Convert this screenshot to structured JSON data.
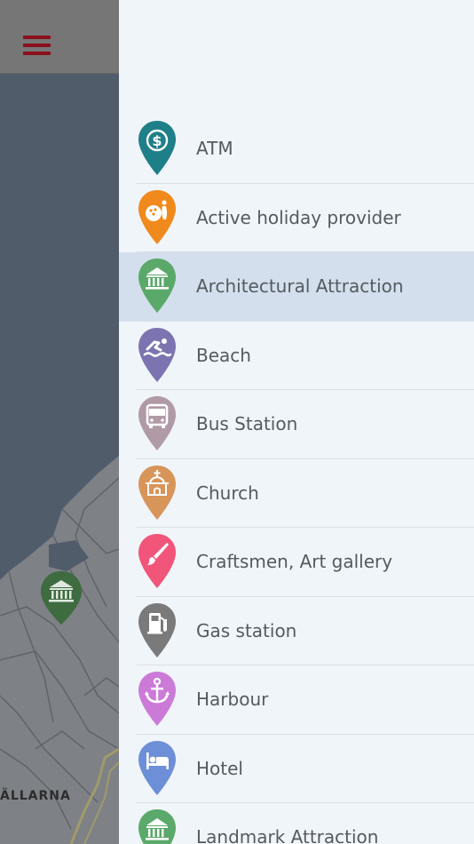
{
  "map": {
    "district_label": "ÄLLARNA",
    "marker_icon": "museum-icon",
    "marker_color": "#3e6b40"
  },
  "header": {
    "menu_icon": "hamburger-menu-icon",
    "menu_color": "#8b0f1a"
  },
  "drawer": {
    "selected_index": 2,
    "items": [
      {
        "label": "ATM",
        "icon": "dollar-icon",
        "color": "#1e7f88"
      },
      {
        "label": "Active holiday provider",
        "icon": "bowling-icon",
        "color": "#f08a1c"
      },
      {
        "label": "Architectural Attraction",
        "icon": "museum-icon",
        "color": "#5aa96a"
      },
      {
        "label": "Beach",
        "icon": "swimmer-icon",
        "color": "#7c74b0"
      },
      {
        "label": "Bus Station",
        "icon": "bus-icon",
        "color": "#b09aa5"
      },
      {
        "label": "Church",
        "icon": "church-icon",
        "color": "#d8955a"
      },
      {
        "label": "Craftsmen, Art gallery",
        "icon": "paintbrush-icon",
        "color": "#f2557a"
      },
      {
        "label": "Gas station",
        "icon": "fuel-pump-icon",
        "color": "#7a7a7a"
      },
      {
        "label": "Harbour",
        "icon": "anchor-icon",
        "color": "#cc7ad8"
      },
      {
        "label": "Hotel",
        "icon": "bed-icon",
        "color": "#6d8fd8"
      },
      {
        "label": "Landmark Attraction",
        "icon": "museum-icon",
        "color": "#5aa96a"
      }
    ]
  }
}
